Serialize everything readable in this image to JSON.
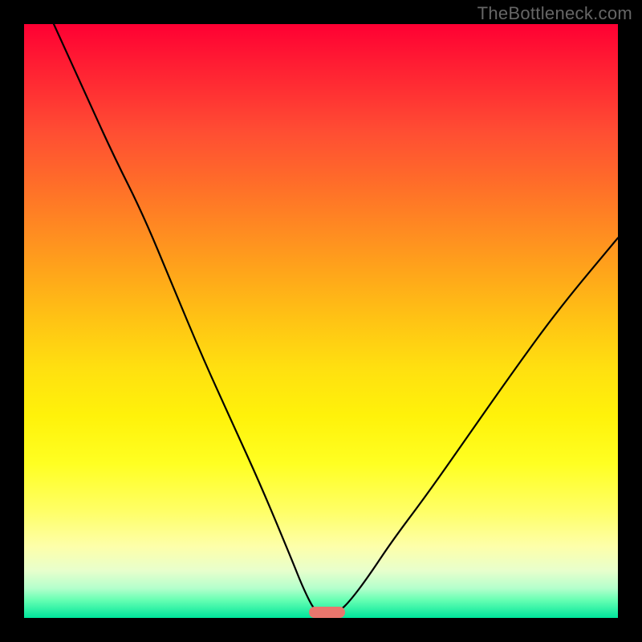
{
  "watermark": "TheBottleneck.com",
  "colors": {
    "page_bg": "#000000",
    "watermark_text": "#666666",
    "curve_stroke": "#000000",
    "marker_fill": "#E9766D",
    "gradient_top": "#FF0033",
    "gradient_bottom": "#00E59B"
  },
  "chart_data": {
    "type": "line",
    "title": "",
    "xlabel": "",
    "ylabel": "",
    "xlim": [
      0,
      100
    ],
    "ylim": [
      0,
      100
    ],
    "grid": false,
    "legend": false,
    "series": [
      {
        "name": "bottleneck-curve",
        "x": [
          5,
          10,
          15,
          20,
          25,
          30,
          35,
          40,
          45,
          47,
          49,
          51,
          53,
          55,
          58,
          62,
          68,
          75,
          82,
          90,
          100
        ],
        "y": [
          100,
          89,
          78,
          68,
          56,
          44,
          33,
          22,
          10,
          5,
          1,
          0,
          1,
          3,
          7,
          13,
          21,
          31,
          41,
          52,
          64
        ]
      }
    ],
    "marker": {
      "x": 51,
      "width_pct": 6,
      "y": 0
    },
    "background": {
      "type": "vertical-gradient",
      "stops": [
        {
          "pct": 0,
          "color": "#FF0033"
        },
        {
          "pct": 50,
          "color": "#FFC414"
        },
        {
          "pct": 80,
          "color": "#FFFF55"
        },
        {
          "pct": 100,
          "color": "#00E59B"
        }
      ]
    }
  }
}
